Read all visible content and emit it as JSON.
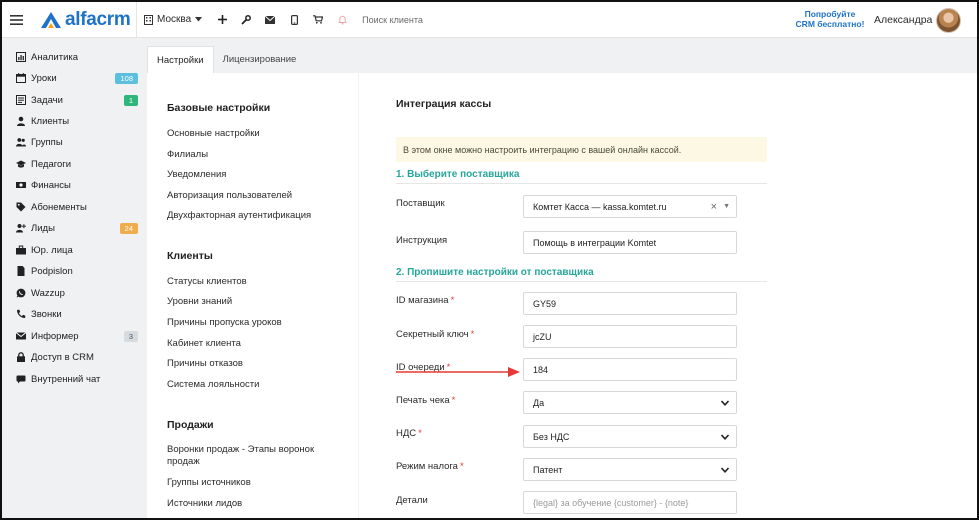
{
  "header": {
    "logo_text": "alfacrm",
    "city": "Москва",
    "search_placeholder": "Поиск клиента",
    "promo_line1": "Попробуйте",
    "promo_line2": "CRM бесплатно!",
    "user_name": "Александра"
  },
  "sidebar": {
    "items": [
      {
        "label": "Аналитика",
        "icon": "chart-icon"
      },
      {
        "label": "Уроки",
        "icon": "calendar-icon",
        "badge": "108",
        "badge_color": "#5bc0de"
      },
      {
        "label": "Задачи",
        "icon": "tasks-icon",
        "badge": "1",
        "badge_color": "#2fb67c"
      },
      {
        "label": "Клиенты",
        "icon": "user-icon"
      },
      {
        "label": "Группы",
        "icon": "users-icon"
      },
      {
        "label": "Педагоги",
        "icon": "graduation-icon"
      },
      {
        "label": "Финансы",
        "icon": "money-icon"
      },
      {
        "label": "Абонементы",
        "icon": "tag-icon"
      },
      {
        "label": "Лиды",
        "icon": "user-plus-icon",
        "badge": "24",
        "badge_color": "#f0ad4e"
      },
      {
        "label": "Юр. лица",
        "icon": "briefcase-icon"
      },
      {
        "label": "Podpislon",
        "icon": "document-icon"
      },
      {
        "label": "Wazzup",
        "icon": "whatsapp-icon"
      },
      {
        "label": "Звонки",
        "icon": "phone-icon"
      },
      {
        "label": "Информер",
        "icon": "envelope-icon",
        "badge": "3",
        "badge_color": "#d6dbe0"
      },
      {
        "label": "Доступ в CRM",
        "icon": "lock-icon"
      },
      {
        "label": "Внутренний чат",
        "icon": "chat-icon"
      }
    ]
  },
  "tabs": [
    {
      "label": "Настройки",
      "active": true
    },
    {
      "label": "Лицензирование",
      "active": false
    }
  ],
  "settings_menu": {
    "sections": [
      {
        "title": "Базовые настройки",
        "links": [
          "Основные настройки",
          "Филиалы",
          "Уведомления",
          "Авторизация пользователей",
          "Двухфакторная аутентификация"
        ]
      },
      {
        "title": "Клиенты",
        "links": [
          "Статусы клиентов",
          "Уровни знаний",
          "Причины пропуска уроков",
          "Кабинет клиента",
          "Причины отказов",
          "Система лояльности"
        ]
      },
      {
        "title": "Продажи",
        "links": [
          "Воронки продаж - Этапы воронок продаж",
          "Группы источников",
          "Источники лидов"
        ]
      }
    ]
  },
  "integration": {
    "title": "Интеграция кассы",
    "info": "В этом окне можно настроить интеграцию с вашей онлайн кассой.",
    "step1": "1. Выберите поставщика",
    "step2": "2. Пропишите настройки от поставщика",
    "provider_label": "Поставщик",
    "provider_value": "Комтет Касса — kassa.komtet.ru",
    "instruction_label": "Инструкция",
    "instruction_value": "Помощь в интеграции Komtet",
    "shop_id_label": "ID магазина",
    "shop_id_value": "GY59",
    "secret_label": "Секретный ключ",
    "secret_value": "jcZU",
    "queue_label": "ID очереди",
    "queue_value": "184",
    "print_label": "Печать чека",
    "print_value": "Да",
    "vat_label": "НДС",
    "vat_value": "Без НДС",
    "tax_label": "Режим налога",
    "tax_value": "Патент",
    "details_label": "Детали",
    "details_placeholder": "{legal} за обучение {customer} - {note}",
    "required_mark": "*"
  },
  "colors": {
    "brand": "#1e73c8",
    "accent_teal": "#26a69a",
    "info_bg": "#fcf8e3",
    "required": "#e53935",
    "arrow": "#e53935"
  }
}
